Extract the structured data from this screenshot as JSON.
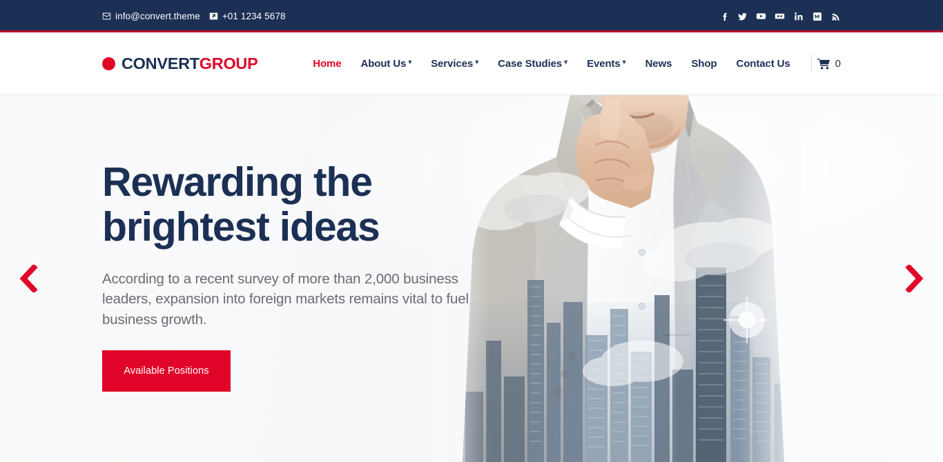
{
  "topbar": {
    "email": "info@convert.theme",
    "phone": "+01 1234 5678",
    "email_icon": "envelope-icon",
    "phone_icon": "phone-icon",
    "social": [
      {
        "name": "facebook-icon",
        "label": "Facebook"
      },
      {
        "name": "twitter-icon",
        "label": "Twitter"
      },
      {
        "name": "youtube-icon",
        "label": "YouTube"
      },
      {
        "name": "flickr-icon",
        "label": "Flickr"
      },
      {
        "name": "linkedin-icon",
        "label": "LinkedIn"
      },
      {
        "name": "medium-icon",
        "label": "Medium"
      },
      {
        "name": "rss-icon",
        "label": "RSS"
      }
    ],
    "bg_color": "#1b3054",
    "accent_line_color": "#b5132e"
  },
  "header": {
    "logo": {
      "part1": "CONVERT",
      "part2": "GROUP",
      "dot_color": "#e00428"
    },
    "nav": [
      {
        "label": "Home",
        "has_dropdown": false,
        "active": true
      },
      {
        "label": "About Us",
        "has_dropdown": true,
        "active": false
      },
      {
        "label": "Services",
        "has_dropdown": true,
        "active": false
      },
      {
        "label": "Case Studies",
        "has_dropdown": true,
        "active": false
      },
      {
        "label": "Events",
        "has_dropdown": true,
        "active": false
      },
      {
        "label": "News",
        "has_dropdown": false,
        "active": false
      },
      {
        "label": "Shop",
        "has_dropdown": false,
        "active": false
      },
      {
        "label": "Contact Us",
        "has_dropdown": false,
        "active": false
      }
    ],
    "cart": {
      "icon": "shopping-cart-icon",
      "count": "0"
    },
    "nav_color": "#1b3054",
    "active_color": "#e00428"
  },
  "hero": {
    "title_line1": "Rewarding the",
    "title_line2": "brightest ideas",
    "subtitle": "According to a recent survey of more than 2,000 business leaders, expansion into foreign markets remains vital to fuel business growth.",
    "cta_label": "Available Positions",
    "cta_color": "#e00428",
    "title_color": "#1b3054",
    "subtitle_color": "#6a6c72",
    "background_color": "#f8f8fa",
    "image_description": "Double exposure of a thoughtful businessman in a grey suit with hand on chin, blended with a blue-grey city skyline and clouds",
    "prev_arrow": "chevron-left-icon",
    "next_arrow": "chevron-right-icon",
    "arrow_color": "#e00428"
  }
}
